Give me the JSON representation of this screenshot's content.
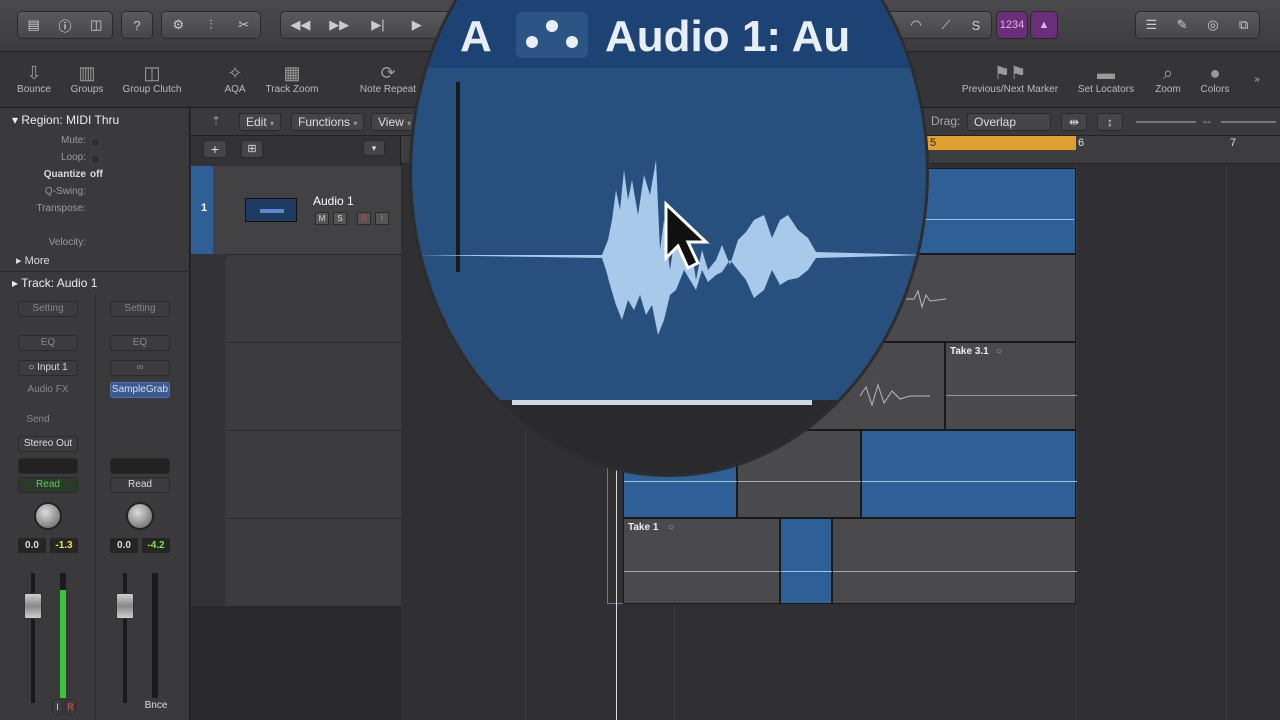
{
  "toolbar": {
    "bounce": "Bounce",
    "groups": "Groups",
    "group_clutch": "Group Clutch",
    "aqa": "AQA",
    "track_zoom": "Track Zoom",
    "note_repeat": "Note Repeat",
    "prev_next_marker": "Previous/Next Marker",
    "set_locators": "Set Locators",
    "zoom": "Zoom",
    "colors": "Colors"
  },
  "controlbar": {
    "lcd": "1234"
  },
  "inspector": {
    "region_header": "Region: MIDI Thru",
    "mute": "Mute:",
    "loop": "Loop:",
    "quantize": "Quantize",
    "quantize_value": "off",
    "qswing": "Q-Swing:",
    "transpose": "Transpose:",
    "velocity": "Velocity:",
    "more": "More",
    "track_header": "Track:  Audio 1",
    "strip1": {
      "setting": "Setting",
      "eq": "EQ",
      "input": "Input 1",
      "audio_fx": "Audio FX",
      "send": "Send",
      "output": "Stereo Out",
      "automation": "Read",
      "vol": "0.0",
      "peak": "-1.3",
      "i_label": "I",
      "r_label": "R"
    },
    "strip2": {
      "setting": "Setting",
      "eq": "EQ",
      "plugin": "SampleGrab",
      "automation": "Read",
      "vol": "0.0",
      "peak": "-4.2",
      "bnce": "Bnce"
    }
  },
  "tracks_header": {
    "edit": "Edit",
    "functions": "Functions",
    "view": "View",
    "drag_label": "Drag:",
    "drag_value": "Overlap"
  },
  "track1": {
    "number": "1",
    "name": "Audio 1",
    "m": "M",
    "s": "S",
    "r": "R",
    "i": "I"
  },
  "ruler": {
    "bar5": "5",
    "bar6": "6",
    "bar7": "7"
  },
  "regions": {
    "take31": "Take 3.1",
    "take1": "Take 1"
  },
  "magnifier": {
    "title": "Audio 1: Au",
    "left_letter": "A"
  },
  "colors": {
    "region_blue": "#2e5f96",
    "accent_yellow": "#e0a030",
    "read_green": "#50d050",
    "peak_yellow": "#e6e64a",
    "peak_green": "#7ce04a"
  }
}
